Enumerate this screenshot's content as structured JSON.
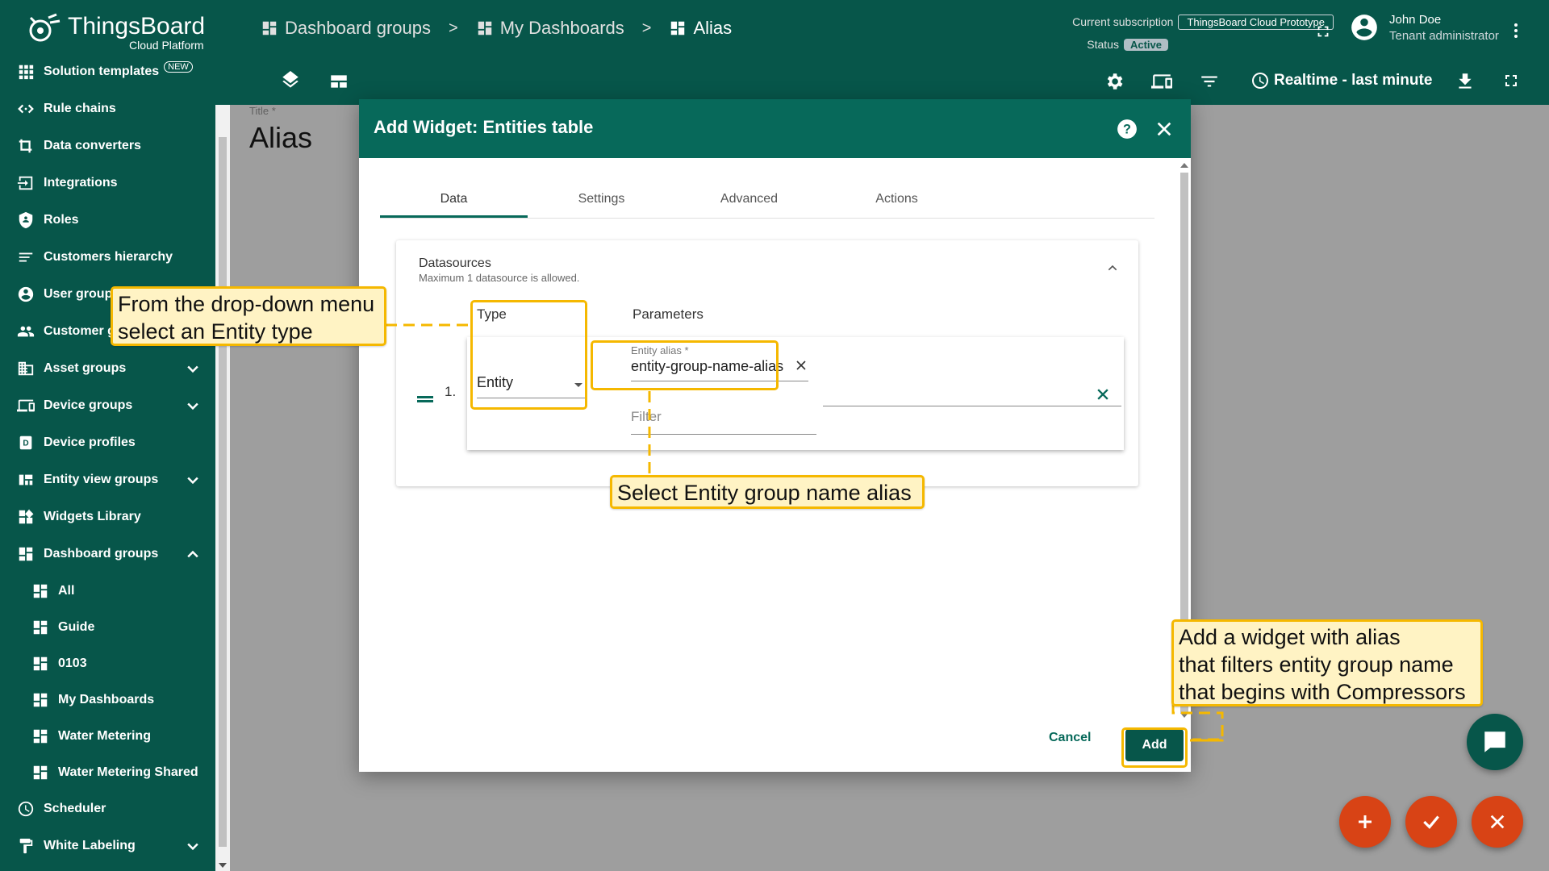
{
  "brand": {
    "name": "ThingsBoard",
    "subtitle": "Cloud Platform"
  },
  "sidebar": {
    "items": [
      {
        "label": "Solution templates",
        "icon": "grid-icon",
        "badge": "NEW"
      },
      {
        "label": "Rule chains",
        "icon": "code-arrows-icon"
      },
      {
        "label": "Data converters",
        "icon": "converter-icon"
      },
      {
        "label": "Integrations",
        "icon": "input-icon"
      },
      {
        "label": "Roles",
        "icon": "shield-icon"
      },
      {
        "label": "Customers hierarchy",
        "icon": "sort-lines-icon"
      },
      {
        "label": "User groups",
        "icon": "account-circle-icon"
      },
      {
        "label": "Customer groups",
        "icon": "people-icon"
      },
      {
        "label": "Asset groups",
        "icon": "domain-icon",
        "expandable": true
      },
      {
        "label": "Device groups",
        "icon": "devices-icon",
        "expandable": true
      },
      {
        "label": "Device profiles",
        "icon": "device-profile-icon"
      },
      {
        "label": "Entity view groups",
        "icon": "view-quilt-icon",
        "expandable": true
      },
      {
        "label": "Widgets Library",
        "icon": "widgets-icon"
      },
      {
        "label": "Dashboard groups",
        "icon": "dashboard-icon",
        "expanded": true
      },
      {
        "label": "All",
        "icon": "dashboard-icon",
        "sub": true
      },
      {
        "label": "Guide",
        "icon": "dashboard-icon",
        "sub": true
      },
      {
        "label": "0103",
        "icon": "dashboard-icon",
        "sub": true
      },
      {
        "label": "My Dashboards",
        "icon": "dashboard-icon",
        "sub": true
      },
      {
        "label": "Water Metering",
        "icon": "dashboard-icon",
        "sub": true
      },
      {
        "label": "Water Metering Shared",
        "icon": "dashboard-icon",
        "sub": true
      },
      {
        "label": "Scheduler",
        "icon": "clock-icon"
      },
      {
        "label": "White Labeling",
        "icon": "paint-roller-icon",
        "expandable": true
      }
    ]
  },
  "header": {
    "breadcrumbs": [
      "Dashboard groups",
      "My Dashboards",
      "Alias"
    ],
    "breadcrumb_sep": ">",
    "subscription_label": "Current subscription",
    "subscription_value": "ThingsBoard Cloud Prototype",
    "status_label": "Status",
    "status_value": "Active",
    "user_name": "John Doe",
    "user_role": "Tenant administrator",
    "timewindow": "Realtime - last minute"
  },
  "page": {
    "title_label": "Title *",
    "title": "Alias"
  },
  "dialog": {
    "title": "Add Widget: Entities table",
    "tabs": [
      "Data",
      "Settings",
      "Advanced",
      "Actions"
    ],
    "active_tab": "Data",
    "datasources_title": "Datasources",
    "datasources_hint": "Maximum 1 datasource is allowed.",
    "col_type": "Type",
    "col_params": "Parameters",
    "row_index": "1.",
    "type_value": "Entity",
    "alias_label": "Entity alias *",
    "alias_value": "entity-group-name-alias",
    "filter_placeholder": "Filter",
    "cancel_label": "Cancel",
    "add_label": "Add"
  },
  "annotations": {
    "type_note_line1": "From the drop-down menu",
    "type_note_line2": "select an Entity type",
    "alias_note": "Select Entity group name alias",
    "add_note_line1": "Add a widget with alias",
    "add_note_line2": "that filters entity group name",
    "add_note_line3": "that begins with Compressors"
  },
  "colors": {
    "primary": "#07564a",
    "dialog_header": "#07695a",
    "highlight": "#f5b800",
    "callout_bg": "#fff3c4",
    "fab": "#d84315"
  }
}
